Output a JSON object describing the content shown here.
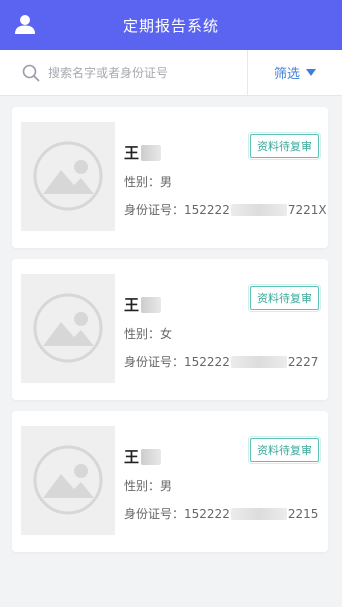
{
  "header": {
    "title": "定期报告系统",
    "user_icon": "user-icon"
  },
  "search": {
    "placeholder": "搜索名字或者身份证号",
    "icon": "search-icon"
  },
  "filter": {
    "label": "筛选",
    "icon": "caret-down-icon"
  },
  "records": [
    {
      "name": "王",
      "gender": "性别：男",
      "id_label": "身份证号：",
      "id_prefix": "152222",
      "id_suffix": "7221X",
      "status": "资料待复审"
    },
    {
      "name": "王",
      "gender": "性别：女",
      "id_label": "身份证号：",
      "id_prefix": "152222",
      "id_suffix": "2227",
      "status": "资料待复审"
    },
    {
      "name": "王",
      "gender": "性别：男",
      "id_label": "身份证号：",
      "id_prefix": "152222",
      "id_suffix": "2215",
      "status": "资料待复审"
    }
  ],
  "colors": {
    "header_bg": "#5b64f0",
    "accent_blue": "#3f7fd9",
    "status_teal": "#38a99b",
    "page_bg": "#f2f3f5"
  }
}
